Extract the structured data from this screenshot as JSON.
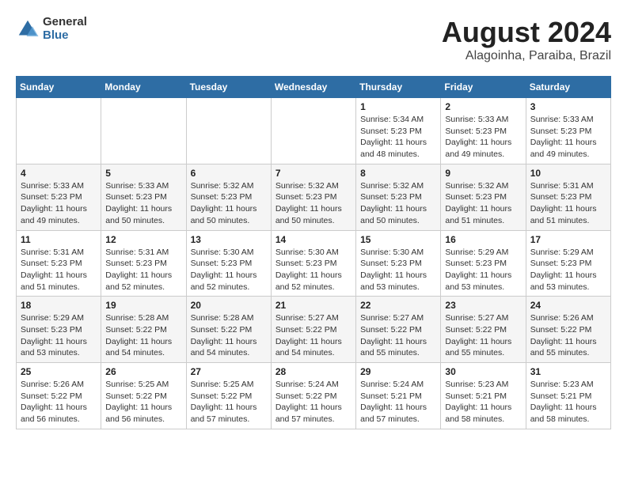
{
  "logo": {
    "general": "General",
    "blue": "Blue"
  },
  "title": "August 2024",
  "subtitle": "Alagoinha, Paraiba, Brazil",
  "days_of_week": [
    "Sunday",
    "Monday",
    "Tuesday",
    "Wednesday",
    "Thursday",
    "Friday",
    "Saturday"
  ],
  "weeks": [
    [
      {
        "day": "",
        "info": ""
      },
      {
        "day": "",
        "info": ""
      },
      {
        "day": "",
        "info": ""
      },
      {
        "day": "",
        "info": ""
      },
      {
        "day": "1",
        "info": "Sunrise: 5:34 AM\nSunset: 5:23 PM\nDaylight: 11 hours and 48 minutes."
      },
      {
        "day": "2",
        "info": "Sunrise: 5:33 AM\nSunset: 5:23 PM\nDaylight: 11 hours and 49 minutes."
      },
      {
        "day": "3",
        "info": "Sunrise: 5:33 AM\nSunset: 5:23 PM\nDaylight: 11 hours and 49 minutes."
      }
    ],
    [
      {
        "day": "4",
        "info": "Sunrise: 5:33 AM\nSunset: 5:23 PM\nDaylight: 11 hours and 49 minutes."
      },
      {
        "day": "5",
        "info": "Sunrise: 5:33 AM\nSunset: 5:23 PM\nDaylight: 11 hours and 50 minutes."
      },
      {
        "day": "6",
        "info": "Sunrise: 5:32 AM\nSunset: 5:23 PM\nDaylight: 11 hours and 50 minutes."
      },
      {
        "day": "7",
        "info": "Sunrise: 5:32 AM\nSunset: 5:23 PM\nDaylight: 11 hours and 50 minutes."
      },
      {
        "day": "8",
        "info": "Sunrise: 5:32 AM\nSunset: 5:23 PM\nDaylight: 11 hours and 50 minutes."
      },
      {
        "day": "9",
        "info": "Sunrise: 5:32 AM\nSunset: 5:23 PM\nDaylight: 11 hours and 51 minutes."
      },
      {
        "day": "10",
        "info": "Sunrise: 5:31 AM\nSunset: 5:23 PM\nDaylight: 11 hours and 51 minutes."
      }
    ],
    [
      {
        "day": "11",
        "info": "Sunrise: 5:31 AM\nSunset: 5:23 PM\nDaylight: 11 hours and 51 minutes."
      },
      {
        "day": "12",
        "info": "Sunrise: 5:31 AM\nSunset: 5:23 PM\nDaylight: 11 hours and 52 minutes."
      },
      {
        "day": "13",
        "info": "Sunrise: 5:30 AM\nSunset: 5:23 PM\nDaylight: 11 hours and 52 minutes."
      },
      {
        "day": "14",
        "info": "Sunrise: 5:30 AM\nSunset: 5:23 PM\nDaylight: 11 hours and 52 minutes."
      },
      {
        "day": "15",
        "info": "Sunrise: 5:30 AM\nSunset: 5:23 PM\nDaylight: 11 hours and 53 minutes."
      },
      {
        "day": "16",
        "info": "Sunrise: 5:29 AM\nSunset: 5:23 PM\nDaylight: 11 hours and 53 minutes."
      },
      {
        "day": "17",
        "info": "Sunrise: 5:29 AM\nSunset: 5:23 PM\nDaylight: 11 hours and 53 minutes."
      }
    ],
    [
      {
        "day": "18",
        "info": "Sunrise: 5:29 AM\nSunset: 5:23 PM\nDaylight: 11 hours and 53 minutes."
      },
      {
        "day": "19",
        "info": "Sunrise: 5:28 AM\nSunset: 5:22 PM\nDaylight: 11 hours and 54 minutes."
      },
      {
        "day": "20",
        "info": "Sunrise: 5:28 AM\nSunset: 5:22 PM\nDaylight: 11 hours and 54 minutes."
      },
      {
        "day": "21",
        "info": "Sunrise: 5:27 AM\nSunset: 5:22 PM\nDaylight: 11 hours and 54 minutes."
      },
      {
        "day": "22",
        "info": "Sunrise: 5:27 AM\nSunset: 5:22 PM\nDaylight: 11 hours and 55 minutes."
      },
      {
        "day": "23",
        "info": "Sunrise: 5:27 AM\nSunset: 5:22 PM\nDaylight: 11 hours and 55 minutes."
      },
      {
        "day": "24",
        "info": "Sunrise: 5:26 AM\nSunset: 5:22 PM\nDaylight: 11 hours and 55 minutes."
      }
    ],
    [
      {
        "day": "25",
        "info": "Sunrise: 5:26 AM\nSunset: 5:22 PM\nDaylight: 11 hours and 56 minutes."
      },
      {
        "day": "26",
        "info": "Sunrise: 5:25 AM\nSunset: 5:22 PM\nDaylight: 11 hours and 56 minutes."
      },
      {
        "day": "27",
        "info": "Sunrise: 5:25 AM\nSunset: 5:22 PM\nDaylight: 11 hours and 57 minutes."
      },
      {
        "day": "28",
        "info": "Sunrise: 5:24 AM\nSunset: 5:22 PM\nDaylight: 11 hours and 57 minutes."
      },
      {
        "day": "29",
        "info": "Sunrise: 5:24 AM\nSunset: 5:21 PM\nDaylight: 11 hours and 57 minutes."
      },
      {
        "day": "30",
        "info": "Sunrise: 5:23 AM\nSunset: 5:21 PM\nDaylight: 11 hours and 58 minutes."
      },
      {
        "day": "31",
        "info": "Sunrise: 5:23 AM\nSunset: 5:21 PM\nDaylight: 11 hours and 58 minutes."
      }
    ]
  ]
}
